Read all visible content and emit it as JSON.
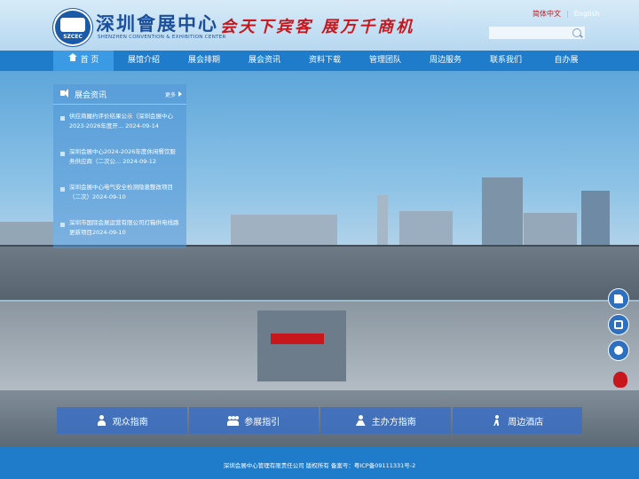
{
  "logo": {
    "cn": "深圳會展中心",
    "en": "SHENZHEN CONVENTION & EXHIBITION CENTER",
    "emblem": "SZCEC"
  },
  "slogan": "会天下宾客  展万千商机",
  "lang": {
    "active": "简体中文",
    "other": "English"
  },
  "search": {
    "placeholder": ""
  },
  "nav": {
    "items": [
      "首 页",
      "展馆介绍",
      "展会排期",
      "展会资讯",
      "资料下载",
      "管理团队",
      "周边服务",
      "联系我们",
      "自办展"
    ]
  },
  "news": {
    "title": "展会资讯",
    "more": "更多",
    "items": [
      "供应商履约评价结果公示（深圳会展中心2023-2026年度开... 2024-09-14",
      "深圳会展中心2024-2026年度休闲餐饮服务供应商（二次公... 2024-09-12",
      "深圳会展中心电气安全检测隐患整改项目（二次）2024-09-10",
      "深圳市国际会展运营有限公司灯箱供电线路更新项目2024-09-10"
    ]
  },
  "quick_links": [
    "观众指南",
    "参展指引",
    "主办方指南",
    "周边酒店"
  ],
  "side_icons": [
    "document-icon",
    "phone-icon",
    "chat-icon"
  ],
  "footer": "深圳会展中心管理有限责任公司 版权所有 备案号：粤ICP备09111331号-2",
  "colors": {
    "nav": "#1f7ccb",
    "nav_active": "#3b9ae4",
    "logo": "#1b4f9c",
    "slogan": "#c8161d"
  }
}
